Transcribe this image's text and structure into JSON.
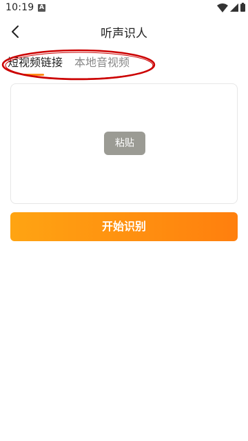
{
  "status_bar": {
    "time": "10:19",
    "notification_icon": "A"
  },
  "header": {
    "title": "听声识人",
    "back_icon": "chevron-left-icon"
  },
  "tabs": [
    {
      "label": "短视频链接",
      "active": true
    },
    {
      "label": "本地音视频",
      "active": false
    }
  ],
  "paste_area": {
    "paste_label": "粘贴"
  },
  "actions": {
    "start_label": "开始识别"
  },
  "colors": {
    "accent": "#ff8c1a",
    "gradient_start": "#ffa412",
    "gradient_end": "#ff7f0e",
    "paste_button": "#9b9b94",
    "annotation": "#cc0000"
  }
}
